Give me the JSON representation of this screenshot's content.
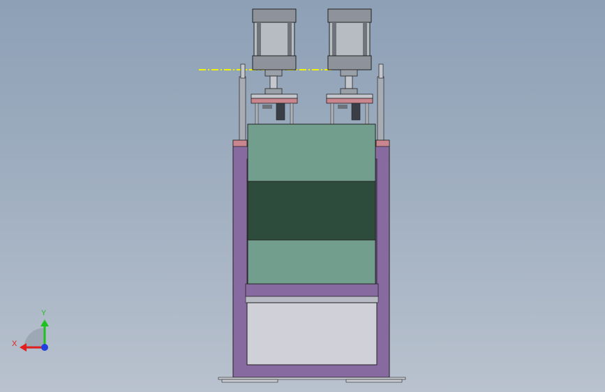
{
  "viewport": {
    "background_top": "#8da0b6",
    "background_bottom": "#b9c2ce"
  },
  "model": {
    "frame_color": "#876aa0",
    "tank_light_color": "#729e8d",
    "tank_dark_color": "#2e4c3b",
    "cylinder_color": "#9aa0a8",
    "cap_color": "#c9868f",
    "drawer_color": "#cfd0d8",
    "reference_line_color": "#f4f400"
  },
  "triad": {
    "x_label": "X",
    "y_label": "Y",
    "x_color": "#e02020",
    "y_color": "#20c020",
    "z_color": "#2040e0"
  }
}
